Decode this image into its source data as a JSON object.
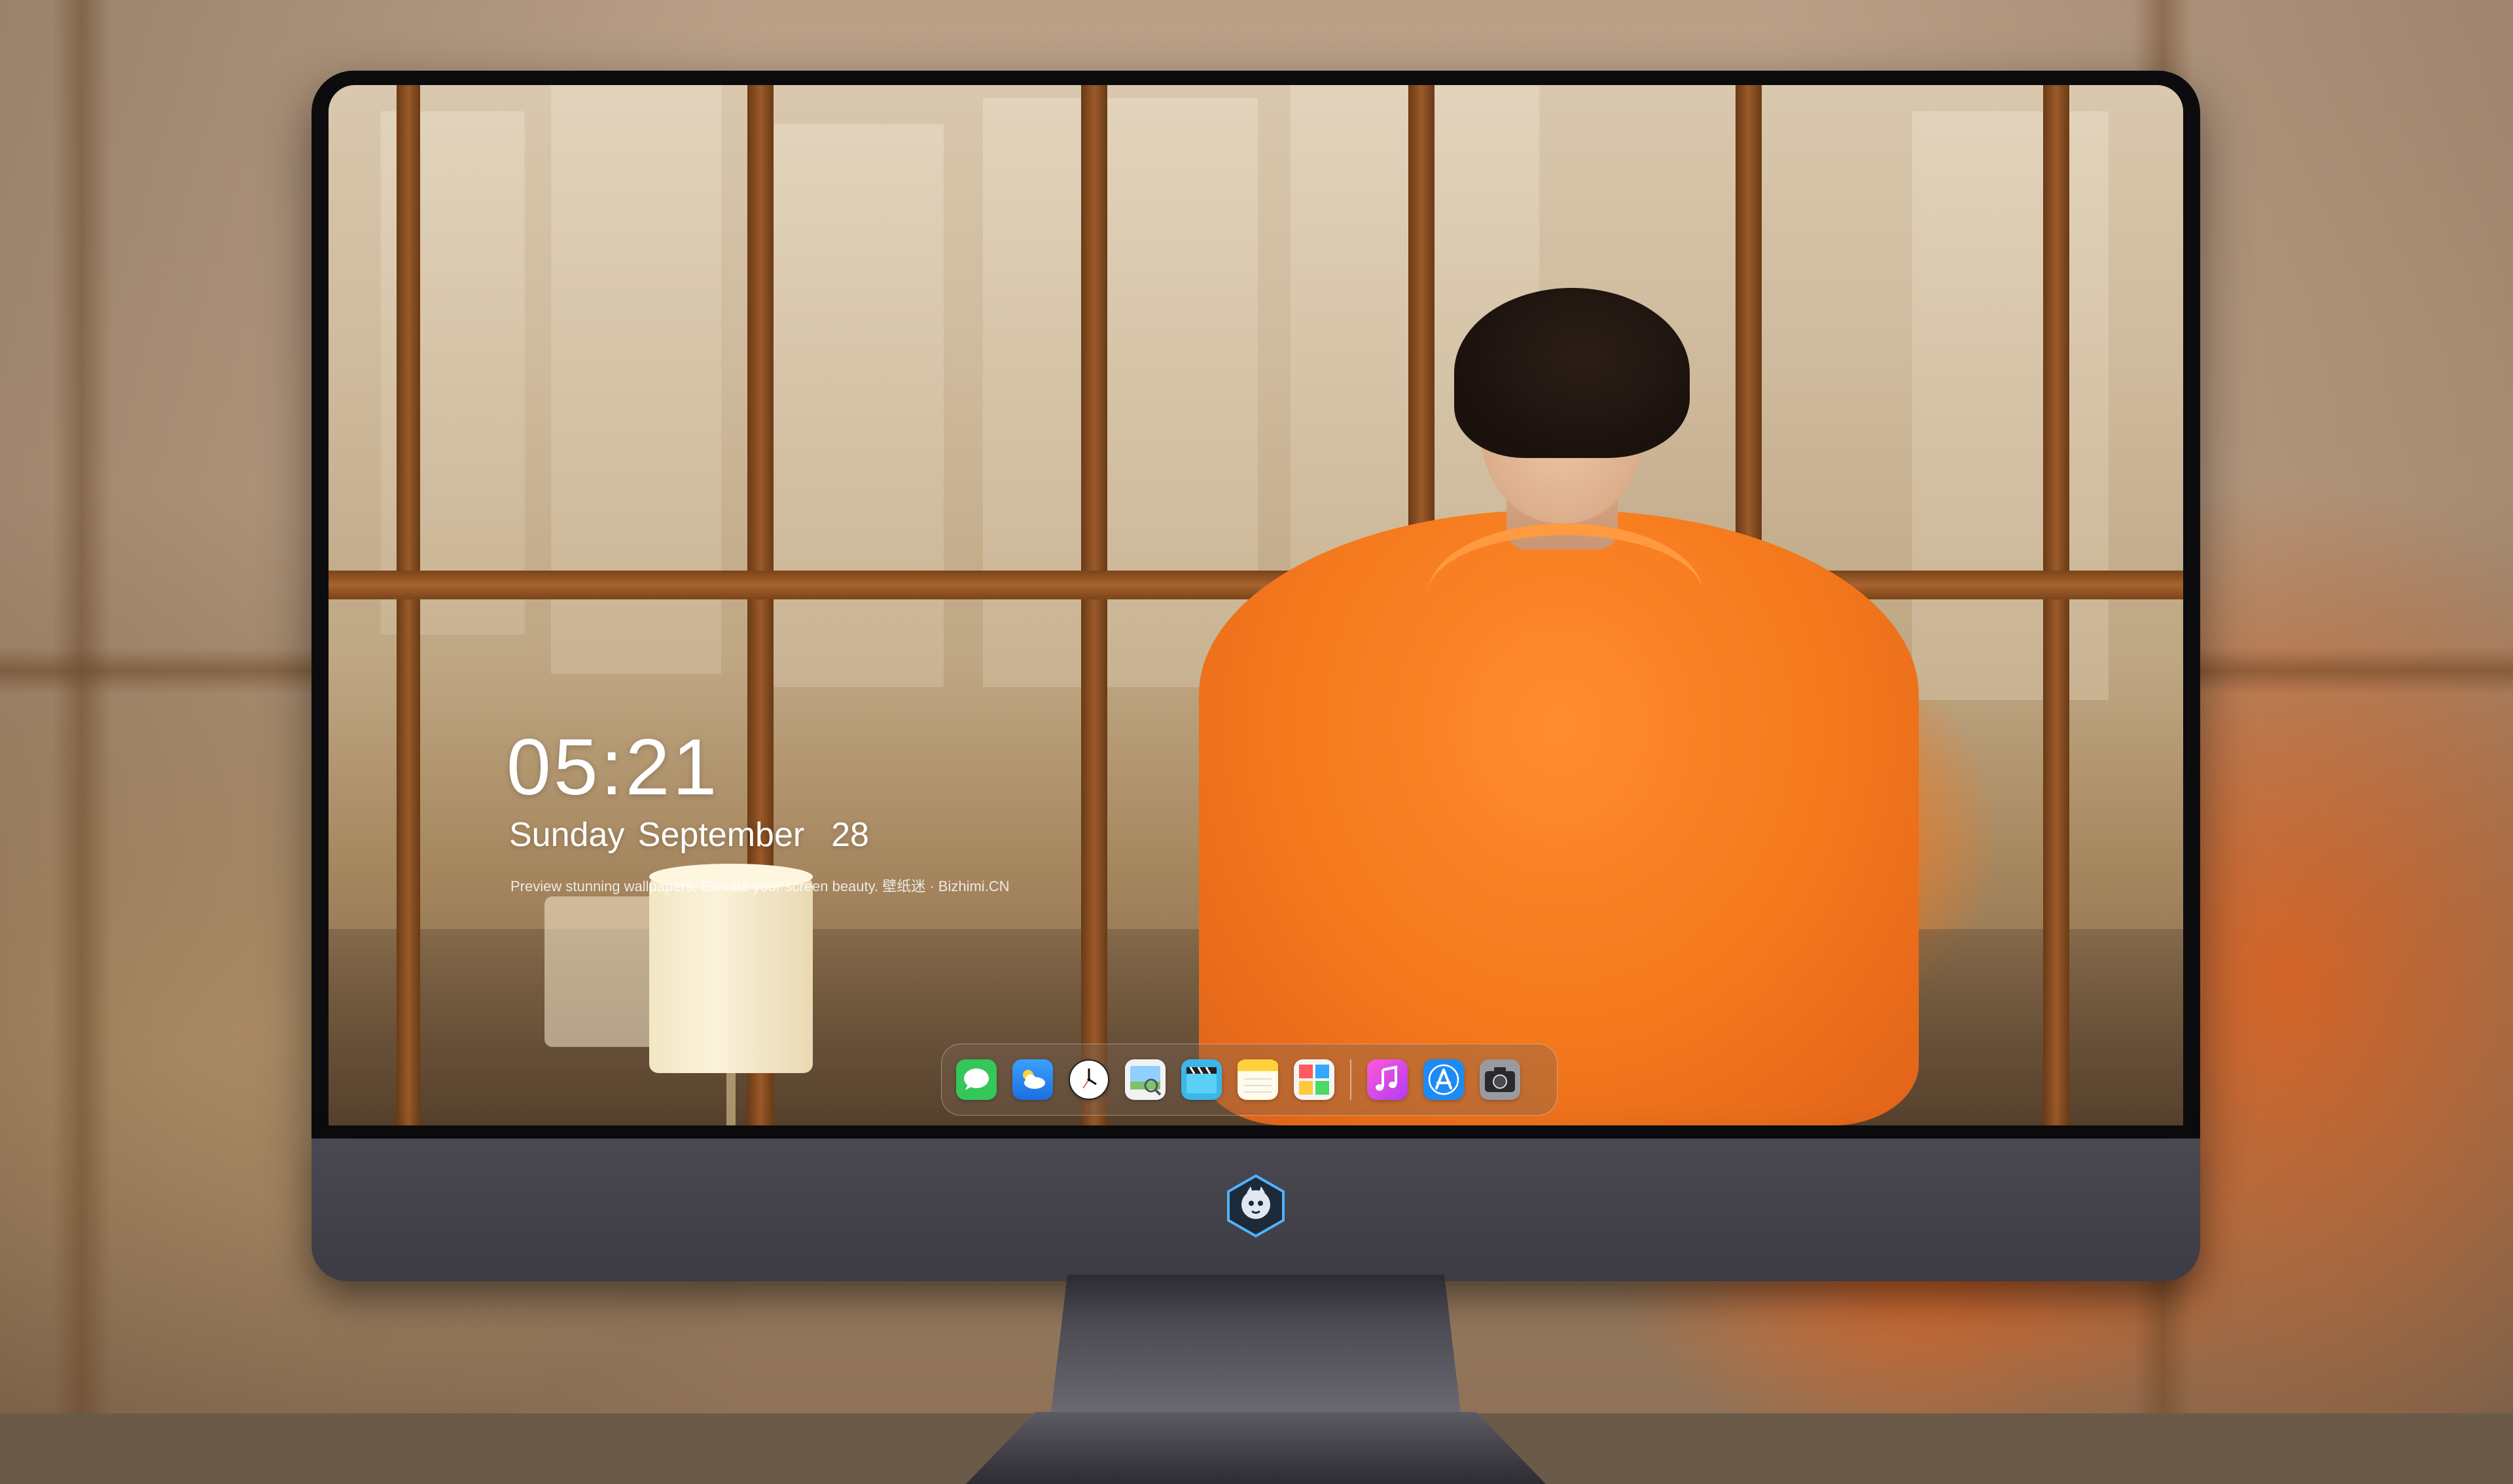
{
  "lockscreen": {
    "time": "05:21",
    "date": "Sunday September  28",
    "tagline": "Preview stunning wallpapers. Elevate your screen beauty. 壁纸迷 · Bizhimi.CN"
  },
  "dock": {
    "apps": [
      {
        "name": "Messages",
        "icon": "messages-icon"
      },
      {
        "name": "Weather",
        "icon": "weather-icon"
      },
      {
        "name": "Clock",
        "icon": "clock-icon"
      },
      {
        "name": "Preview",
        "icon": "preview-icon"
      },
      {
        "name": "Clips",
        "icon": "clips-icon"
      },
      {
        "name": "Notes",
        "icon": "notes-icon"
      },
      {
        "name": "Photo Booth",
        "icon": "photo-grid-icon"
      },
      {
        "name": "Music",
        "icon": "music-icon"
      },
      {
        "name": "App Store",
        "icon": "app-store-icon"
      },
      {
        "name": "Camera",
        "icon": "camera-icon"
      }
    ]
  },
  "colors": {
    "accent": "#f4781c",
    "bezel": "#0c0c0e",
    "chin": "#4a4851"
  }
}
